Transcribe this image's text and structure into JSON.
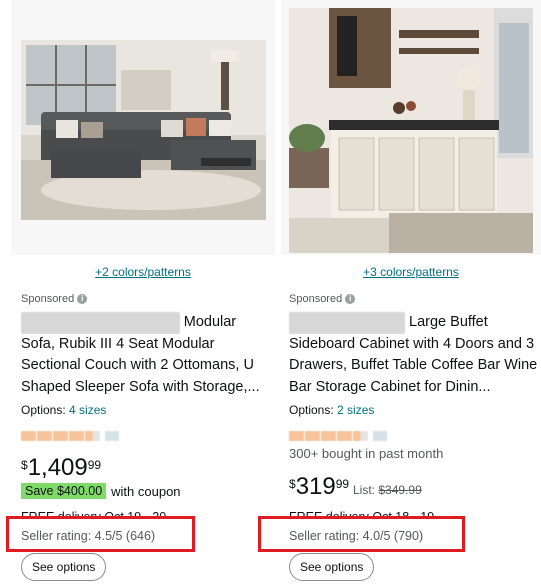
{
  "cards": [
    {
      "colors_link": "+2 colors/patterns",
      "sponsored": "Sponsored",
      "title_visible": "Sofa, Rubik III 4 Seat Modular Sectional Couch with 2 Ottomans, U Shaped Sleeper Sofa with Storage,...",
      "title_line1_tail": "Modular",
      "options_label": "Options:",
      "options_value": "4 sizes",
      "price_symbol": "$",
      "price_whole": "1,409",
      "price_fraction": "99",
      "coupon_badge": "Save $400.00",
      "coupon_text": "with coupon",
      "delivery": "FREE delivery Oct 19 - 20",
      "seller_rating": "Seller rating: 4.5/5 (646)",
      "button": "See options"
    },
    {
      "colors_link": "+3 colors/patterns",
      "sponsored": "Sponsored",
      "title_line1_tail": "Large Buffet",
      "title_visible": "Sideboard Cabinet with 4 Doors and 3 Drawers, Buffet Table Coffee Bar Wine Bar Storage Cabinet for Dinin...",
      "options_label": "Options:",
      "options_value": "2 sizes",
      "bought": "300+ bought in past month",
      "price_symbol": "$",
      "price_whole": "319",
      "price_fraction": "99",
      "list_label": "List:",
      "list_price": "$349.99",
      "delivery": "FREE delivery Oct 18 - 19",
      "seller_rating": "Seller rating: 4.0/5 (790)",
      "button": "See options"
    }
  ],
  "colors": {
    "link": "#007185",
    "highlight": "#e11b22",
    "coupon": "#7fda69",
    "stars": "#f5b98a"
  }
}
